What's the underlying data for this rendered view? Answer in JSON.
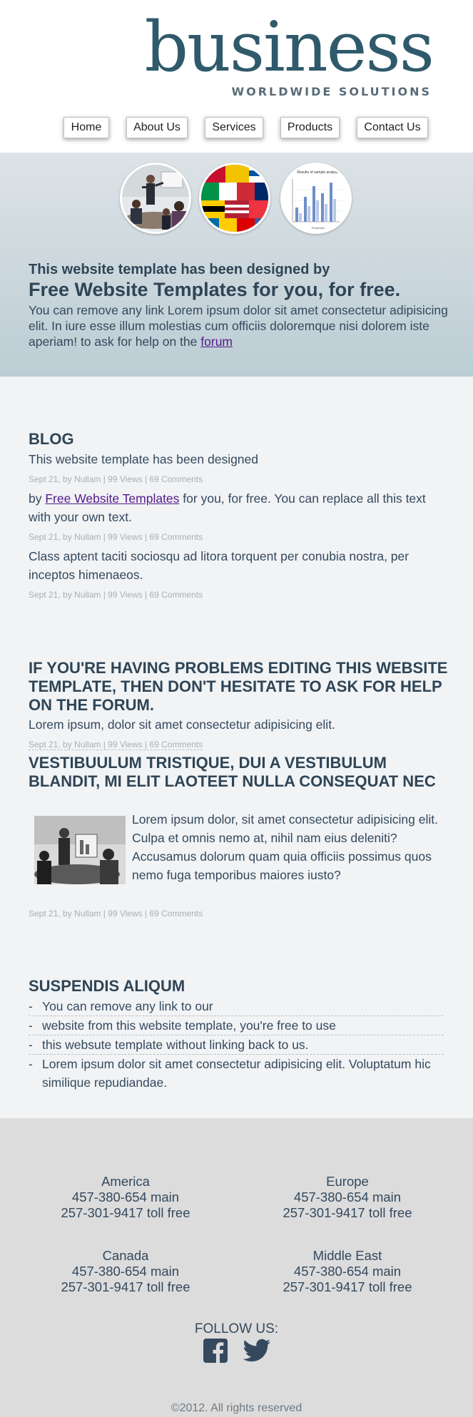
{
  "header": {
    "logo_word": "business",
    "logo_sub": "WORLDWIDE SOLUTIONS"
  },
  "nav": [
    "Home",
    "About Us",
    "Services",
    "Products",
    "Contact Us"
  ],
  "hero": {
    "chart_title": "Results of sample analysis",
    "chart_xlabel": "Parameter",
    "line1": "This website template has been designed by",
    "line2": "Free Website Templates for you, for free.",
    "para": "You can remove any link Lorem ipsum dolor sit amet consectetur adipisicing elit. In iure esse illum molestias cum officiis doloremque nisi dolorem iste aperiam! to ask for help on the",
    "link": "forum"
  },
  "blog": {
    "title": "BLOG",
    "post1": "This website template has been designed",
    "meta": "Sept 21, by Nullam | 99 Views | 69 Comments",
    "post2_prefix": "by",
    "post2_link": "Free Website Templates",
    "post2_rest": "for you, for free. You can replace all this text with your own text.",
    "post3": "Class aptent taciti sociosqu ad litora torquent per conubia nostra, per inceptos himenaeos."
  },
  "problems": {
    "title": "IF YOU'RE HAVING PROBLEMS EDITING THIS WEBSITE TEMPLATE, THEN DON'T HESITATE TO ASK FOR HELP ON THE FORUM.",
    "text": "Lorem ipsum, dolor sit amet consectetur adipisicing elit.",
    "meta": "Sept 21, by Nullam | 99 Views | 69 Comments"
  },
  "vestibulum": {
    "title": "VESTIBUULUM TRISTIQUE, DUI A VESTIBULUM BLANDIT, MI ELIT LAOTEET NULLA CONSEQUAT NEC",
    "text": "Lorem ipsum dolor, sit amet consectetur adipisicing elit. Culpa et omnis nemo at, nihil nam eius deleniti? Accusamus dolorum quam quia officiis possimus quos nemo fuga temporibus maiores iusto?",
    "meta": "Sept 21, by Nullam | 99 Views | 69 Comments"
  },
  "suspendis": {
    "title": "SUSPENDIS ALIQUM",
    "items": [
      "You can remove any link to our",
      "website from this website template, you're free to use",
      "this websute template without linking back to us.",
      "Lorem ipsum dolor sit amet consectetur adipisicing elit. Voluptatum hic similique repudiandae."
    ]
  },
  "footer": {
    "offices": [
      {
        "region": "America",
        "main": "457-380-654 main",
        "toll": "257-301-9417 toll free"
      },
      {
        "region": "Europe",
        "main": "457-380-654 main",
        "toll": "257-301-9417 toll free"
      },
      {
        "region": "Canada",
        "main": "457-380-654 main",
        "toll": "257-301-9417 toll free"
      },
      {
        "region": "Middle East",
        "main": "457-380-654 main",
        "toll": "257-301-9417 toll free"
      }
    ],
    "follow": "FOLLOW US:",
    "social_icons": [
      "facebook-icon",
      "twitter-icon"
    ],
    "copyright": "©2012. All rights reserved"
  }
}
